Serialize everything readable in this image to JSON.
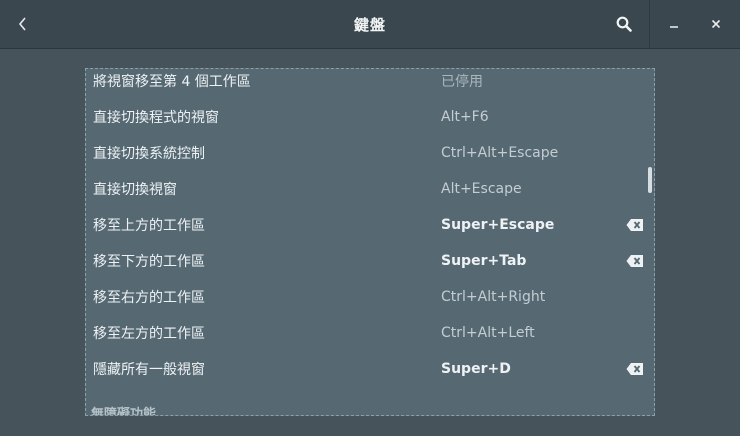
{
  "header": {
    "title": "鍵盤",
    "back_icon": "chevron-left-icon",
    "search_icon": "search-icon",
    "minimize_icon": "minimize-icon",
    "close_icon": "close-icon"
  },
  "shortcuts": [
    {
      "name": "將視窗移至第 4 個工作區",
      "shortcut": "已停用",
      "state": "disabled",
      "resettable": false
    },
    {
      "name": "直接切換程式的視窗",
      "shortcut": "Alt+F6",
      "state": "default",
      "resettable": false
    },
    {
      "name": "直接切換系統控制",
      "shortcut": "Ctrl+Alt+Escape",
      "state": "default",
      "resettable": false
    },
    {
      "name": "直接切換視窗",
      "shortcut": "Alt+Escape",
      "state": "default",
      "resettable": false
    },
    {
      "name": "移至上方的工作區",
      "shortcut": "Super+Escape",
      "state": "custom",
      "resettable": true
    },
    {
      "name": "移至下方的工作區",
      "shortcut": "Super+Tab",
      "state": "custom",
      "resettable": true
    },
    {
      "name": "移至右方的工作區",
      "shortcut": "Ctrl+Alt+Right",
      "state": "default",
      "resettable": false
    },
    {
      "name": "移至左方的工作區",
      "shortcut": "Ctrl+Alt+Left",
      "state": "default",
      "resettable": false
    },
    {
      "name": "隱藏所有一般視窗",
      "shortcut": "Super+D",
      "state": "custom",
      "resettable": true
    }
  ],
  "next_section": "無障礙功能",
  "reset_icon": "backspace-icon"
}
